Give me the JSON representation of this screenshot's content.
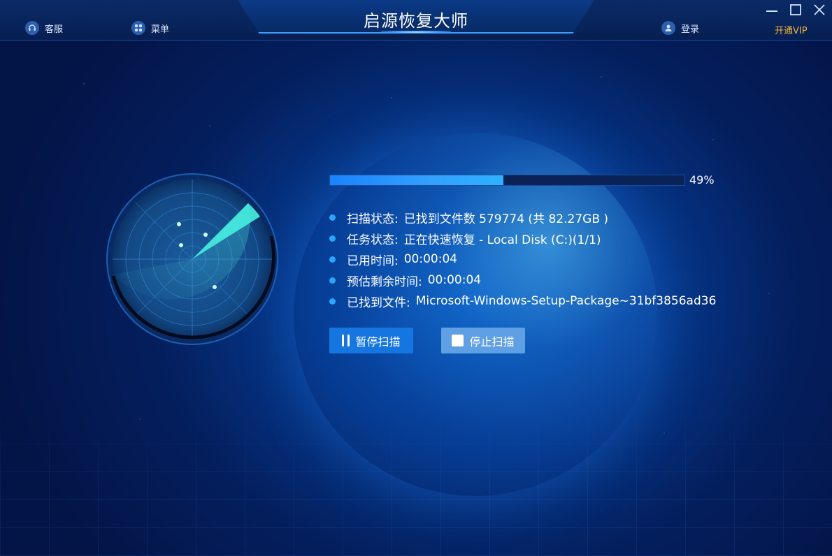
{
  "app": {
    "title": "启源恢复大师"
  },
  "topbar": {
    "service_label": "客服",
    "menu_label": "菜单",
    "login_label": "登录",
    "vip_label": "开通VIP"
  },
  "colors": {
    "background": "#041f5e",
    "progress_fill": "#1c82ff",
    "bullet": "#2aa6ff",
    "vip": "#f0b43c",
    "pause_button": "#1576e0",
    "stop_button": "#5f9fe4"
  },
  "progress": {
    "value": 0.49,
    "text": "49%"
  },
  "status": [
    {
      "label": "扫描状态:",
      "value": "已找到文件数 579774 (共 82.27GB )"
    },
    {
      "label": "任务状态:",
      "value": "正在快速恢复 - Local Disk (C:)(1/1)"
    },
    {
      "label": "已用时间:",
      "value": "00:00:04"
    },
    {
      "label": "预估剩余时间:",
      "value": "00:00:04"
    },
    {
      "label": "已找到文件:",
      "value": "Microsoft-Windows-Setup-Package~31bf3856ad36"
    }
  ],
  "buttons": {
    "pause_label": "暂停扫描",
    "stop_label": "停止扫描"
  },
  "icons": {
    "service": "headset-icon",
    "menu": "grid-icon",
    "login": "user-icon",
    "minimize": "minimize-icon",
    "maximize": "maximize-icon",
    "close": "close-icon",
    "pause": "pause-icon",
    "stop": "stop-icon"
  }
}
